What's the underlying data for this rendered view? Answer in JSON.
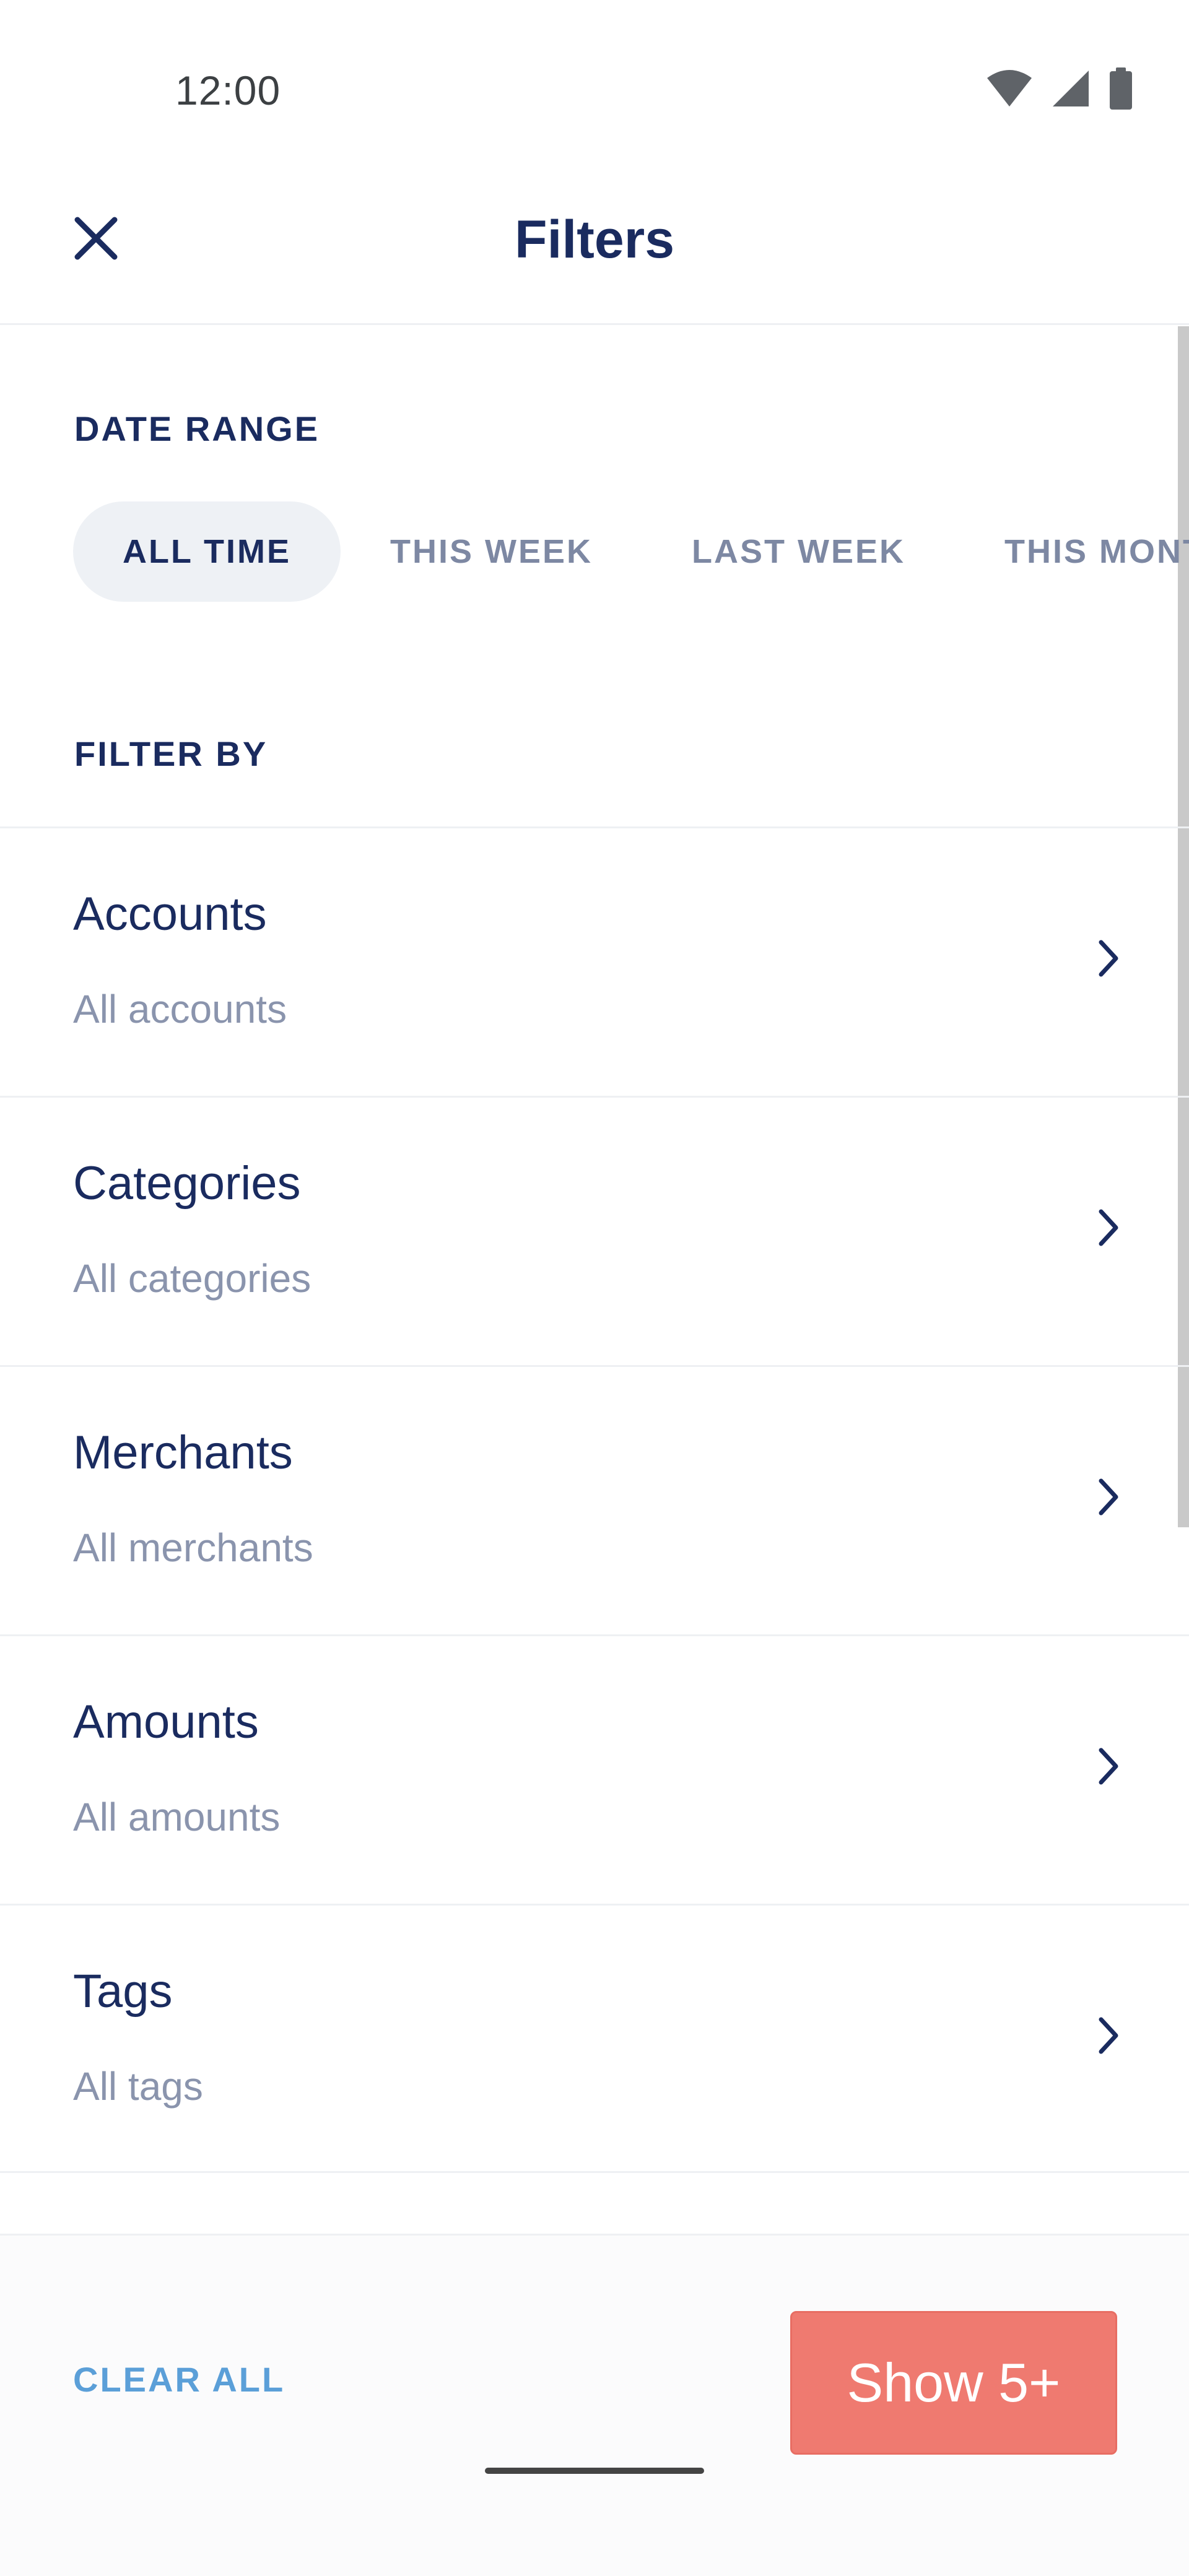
{
  "status_bar": {
    "time": "12:00",
    "icons": [
      "wifi-icon",
      "cellular-signal-icon",
      "battery-icon"
    ]
  },
  "header": {
    "title": "Filters",
    "close_icon": "close-icon"
  },
  "date_range": {
    "label": "DATE RANGE",
    "chips": [
      {
        "label": "ALL TIME",
        "selected": true
      },
      {
        "label": "THIS WEEK",
        "selected": false
      },
      {
        "label": "LAST WEEK",
        "selected": false
      },
      {
        "label": "THIS MONTH",
        "selected": false
      }
    ]
  },
  "filter_by": {
    "label": "FILTER BY",
    "items": [
      {
        "title": "Accounts",
        "subtitle": "All accounts"
      },
      {
        "title": "Categories",
        "subtitle": "All categories"
      },
      {
        "title": "Merchants",
        "subtitle": "All merchants"
      },
      {
        "title": "Amounts",
        "subtitle": "All amounts"
      },
      {
        "title": "Tags",
        "subtitle": "All tags"
      }
    ]
  },
  "actions": {
    "clear_all": "CLEAR ALL",
    "show": "Show 5+"
  },
  "colors": {
    "primary_text": "#1a2b5f",
    "muted_text": "#8a94ad",
    "link": "#5b9fd8",
    "accent_button": "#ef7a70",
    "chip_selected_bg": "#eef1f5"
  }
}
